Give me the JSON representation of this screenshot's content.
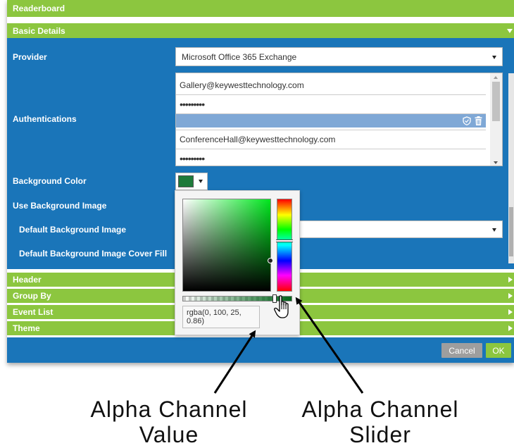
{
  "window": {
    "title": "Readerboard"
  },
  "sections": {
    "basic_details": "Basic Details",
    "header": "Header",
    "group_by": "Group By",
    "event_list": "Event List",
    "theme": "Theme"
  },
  "fields": {
    "provider_label": "Provider",
    "provider_value": "Microsoft Office 365 Exchange",
    "authentications_label": "Authentications",
    "authentications": [
      {
        "email": "Gallery@keywesttechnology.com",
        "password": "•••••••••"
      },
      {
        "email": "ConferenceHall@keywesttechnology.com",
        "password": "•••••••••"
      }
    ],
    "background_color_label": "Background Color",
    "background_color_value": "#1e7a3a",
    "use_background_image_label": "Use Background Image",
    "default_background_image_label": "Default Background Image",
    "default_background_image_cover_fill_label": "Default Background Image Cover Fill"
  },
  "color_picker": {
    "value_text": "rgba(0, 100, 25, 0.86)",
    "alpha": 0.86
  },
  "footer": {
    "cancel_label": "Cancel",
    "ok_label": "OK"
  },
  "annotations": {
    "alpha_value_line1": "Alpha Channel",
    "alpha_value_line2": "Value",
    "alpha_slider_line1": "Alpha Channel",
    "alpha_slider_line2": "Slider"
  },
  "colors": {
    "header_green": "#8cc63f",
    "body_blue": "#1a75b9",
    "cancel_gray": "#9e9e9e",
    "ok_green": "#8cc63f",
    "selected_row_blue": "#7fa8d6"
  },
  "icons": [
    "shield-icon",
    "trash-icon",
    "chevron-down-icon",
    "chevron-right-icon",
    "hand-cursor-icon"
  ]
}
